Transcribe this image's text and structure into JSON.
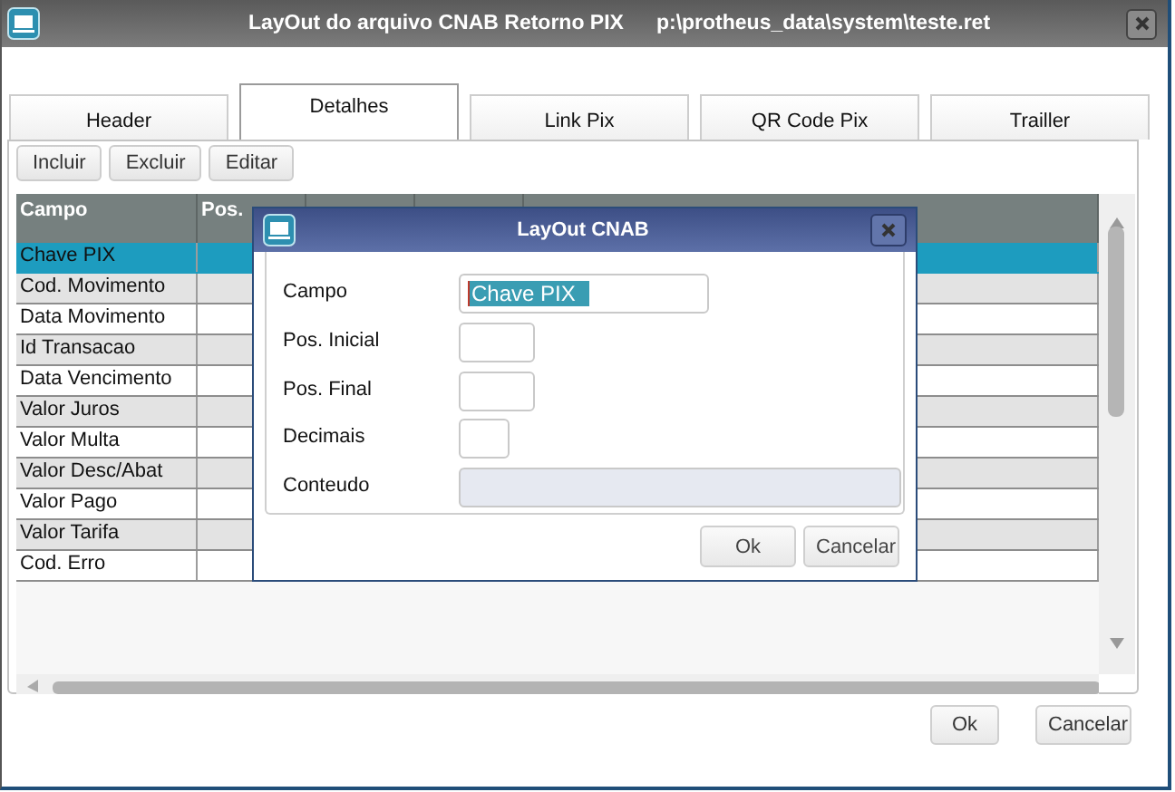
{
  "window": {
    "title": "LayOut do arquivo CNAB Retorno PIX",
    "path": "p:\\protheus_data\\system\\teste.ret"
  },
  "tabs": [
    {
      "label": "Header",
      "selected": false
    },
    {
      "label": "Detalhes",
      "selected": true
    },
    {
      "label": "Link Pix",
      "selected": false
    },
    {
      "label": "QR Code Pix",
      "selected": false
    },
    {
      "label": "Trailler",
      "selected": false
    }
  ],
  "toolbar": [
    "Incluir",
    "Excluir",
    "Editar"
  ],
  "table": {
    "columns": [
      "Campo",
      "Pos."
    ],
    "rows": [
      {
        "campo": "Chave PIX",
        "selected": true
      },
      {
        "campo": "Cod. Movimento",
        "selected": false
      },
      {
        "campo": "Data Movimento",
        "selected": false
      },
      {
        "campo": "Id Transacao",
        "selected": false
      },
      {
        "campo": "Data Vencimento",
        "selected": false
      },
      {
        "campo": "Valor Juros",
        "selected": false
      },
      {
        "campo": "Valor Multa",
        "selected": false
      },
      {
        "campo": "Valor Desc/Abat",
        "selected": false
      },
      {
        "campo": "Valor Pago",
        "selected": false
      },
      {
        "campo": "Valor Tarifa",
        "selected": false
      },
      {
        "campo": "Cod. Erro",
        "selected": false
      }
    ]
  },
  "buttons": [
    "Ok",
    "Cancelar"
  ],
  "dialog": {
    "title": "LayOut CNAB",
    "fields": [
      {
        "label": "Campo",
        "value": "Chave PIX",
        "selected_text": true,
        "disabled": false
      },
      {
        "label": "Pos. Inicial",
        "disabled": false
      },
      {
        "label": "Pos. Final",
        "disabled": false
      },
      {
        "label": "Decimais",
        "disabled": false
      },
      {
        "label": "Conteudo",
        "disabled": true
      }
    ],
    "buttons": [
      "Ok",
      "Cancelar"
    ]
  }
}
